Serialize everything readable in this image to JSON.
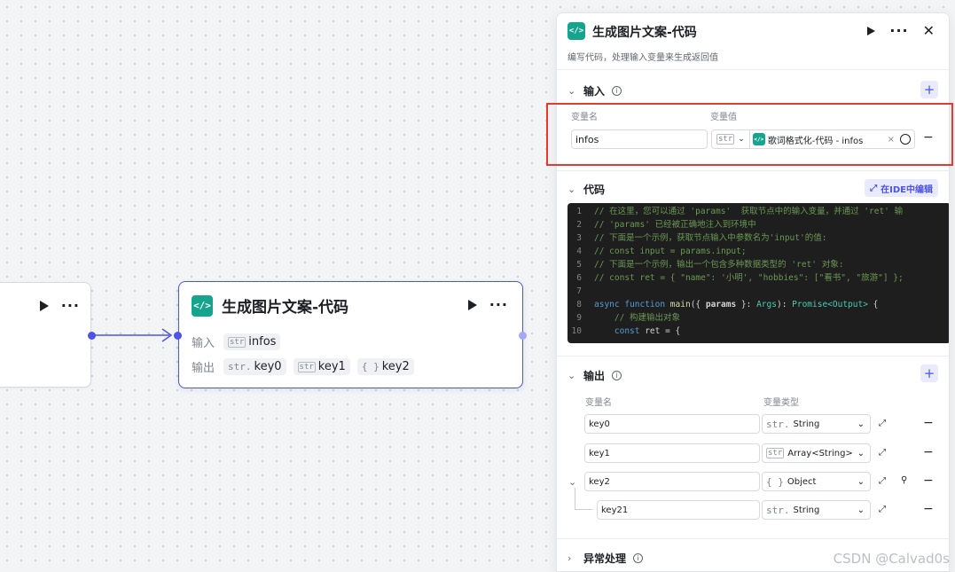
{
  "canvas": {
    "main_node": {
      "title": "生成图片文案-代码",
      "input_label": "输入",
      "output_label": "输出",
      "inputs": [
        {
          "type_tag": "str",
          "name": "infos"
        }
      ],
      "outputs": [
        {
          "type_tag": "str.",
          "name": "key0"
        },
        {
          "type_tag": "str",
          "name": "key1"
        },
        {
          "type_tag": "{ }",
          "name": "key2"
        }
      ]
    }
  },
  "panel": {
    "title": "生成图片文案-代码",
    "description": "编写代码，处理输入变量来生成返回值",
    "input_section": {
      "title": "输入",
      "col_name": "变量名",
      "col_value": "变量值",
      "rows": [
        {
          "name": "infos",
          "type_tag": "str",
          "ref_label": "歌词格式化-代码 - infos"
        }
      ]
    },
    "code_section": {
      "title": "代码",
      "ide_button": "在IDE中编辑",
      "lines": [
        {
          "n": "1",
          "text": "// 在这里，您可以通过 'params'  获取节点中的输入变量，并通过 'ret' 输"
        },
        {
          "n": "2",
          "text": "// 'params' 已经被正确地注入到环境中"
        },
        {
          "n": "3",
          "text": "// 下面是一个示例，获取节点输入中参数名为'input'的值:"
        },
        {
          "n": "4",
          "text": "// const input = params.input;"
        },
        {
          "n": "5",
          "text": "// 下面是一个示例，输出一个包含多种数据类型的 'ret' 对象:"
        },
        {
          "n": "6",
          "text": "// const ret = { \"name\": '小明', \"hobbies\": [\"看书\", \"旅游\"] };"
        },
        {
          "n": "7",
          "text": ""
        },
        {
          "n": "8",
          "kw": "async function ",
          "fn": "main",
          "tx1": "({ ",
          "p": "params",
          "tx2": " }: ",
          "ty": "Args",
          "tx3": "): ",
          "ty2": "Promise<Output>",
          "tx4": " {"
        },
        {
          "n": "9",
          "text": "    // 构建输出对象"
        },
        {
          "n": "10",
          "kw": "    const ",
          "tx1": "ret = {"
        }
      ]
    },
    "output_section": {
      "title": "输出",
      "col_name": "变量名",
      "col_type": "变量类型",
      "rows": [
        {
          "name": "key0",
          "type_icon": "str.",
          "type": "String"
        },
        {
          "name": "key1",
          "type_icon": "str",
          "type": "Array<String>"
        },
        {
          "name": "key2",
          "type_icon": "{ }",
          "type": "Object"
        },
        {
          "name": "key21",
          "type_icon": "str.",
          "type": "String"
        }
      ]
    },
    "error_section": {
      "title": "异常处理"
    }
  },
  "watermark": "CSDN @Calvad0s",
  "colors": {
    "accent": "#4d53e8",
    "code_badge": "#14a58c",
    "highlight_frame": "#e53935"
  }
}
